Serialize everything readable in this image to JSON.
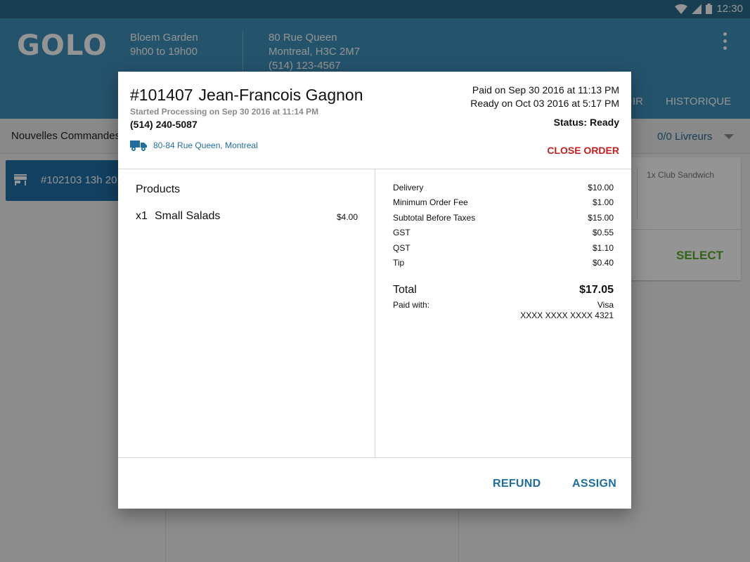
{
  "status_bar": {
    "time": "12:30"
  },
  "app_bar": {
    "logo": "GOLO",
    "store_name": "Bloem Garden",
    "store_hours": "9h00 to 19h00",
    "address_line1": "80 Rue Queen",
    "address_line2": "Montreal, H3C 2M7",
    "address_phone": "(514) 123-4567",
    "tab_partial": "IR",
    "tab_history": "HISTORIQUE"
  },
  "sub_bar": {
    "new_orders": "Nouvelles Commandes",
    "couriers": "0/0 Livreurs"
  },
  "order_card": {
    "label": "#102103  13h 20"
  },
  "detail_card": {
    "items": "1x Club Sandwich",
    "select_label": "SELECT"
  },
  "dialog": {
    "order_number": "#101407",
    "customer": "Jean-Francois Gagnon",
    "started": "Started Processing on Sep 30 2016 at 11:14 PM",
    "phone": "(514) 240-5087",
    "delivery_address": "80-84 Rue Queen, Montreal",
    "paid_on": "Paid on Sep 30 2016 at 11:13 PM",
    "ready_on": "Ready on Oct 03 2016 at 5:17 PM",
    "status": "Status: Ready",
    "close_order": "CLOSE ORDER",
    "products_heading": "Products",
    "products": [
      {
        "qty": "x1",
        "name": "Small Salads",
        "price": "$4.00"
      }
    ],
    "fees": [
      {
        "label": "Delivery",
        "value": "$10.00"
      },
      {
        "label": "Minimum Order Fee",
        "value": "$1.00"
      },
      {
        "label": "Subtotal Before Taxes",
        "value": "$15.00"
      },
      {
        "label": "GST",
        "value": "$0.55"
      },
      {
        "label": "QST",
        "value": "$1.10"
      },
      {
        "label": "Tip",
        "value": "$0.40"
      }
    ],
    "total_label": "Total",
    "total_value": "$17.05",
    "paid_with_label": "Paid with:",
    "paid_with_method": "Visa",
    "paid_with_card": "XXXX XXXX XXXX 4321",
    "refund_label": "REFUND",
    "assign_label": "ASSIGN"
  },
  "colors": {
    "app_bar": "#3e8fbb",
    "accent_blue": "#1f6e9f",
    "danger_red": "#c51d1d",
    "select_green": "#5aaa2c"
  }
}
